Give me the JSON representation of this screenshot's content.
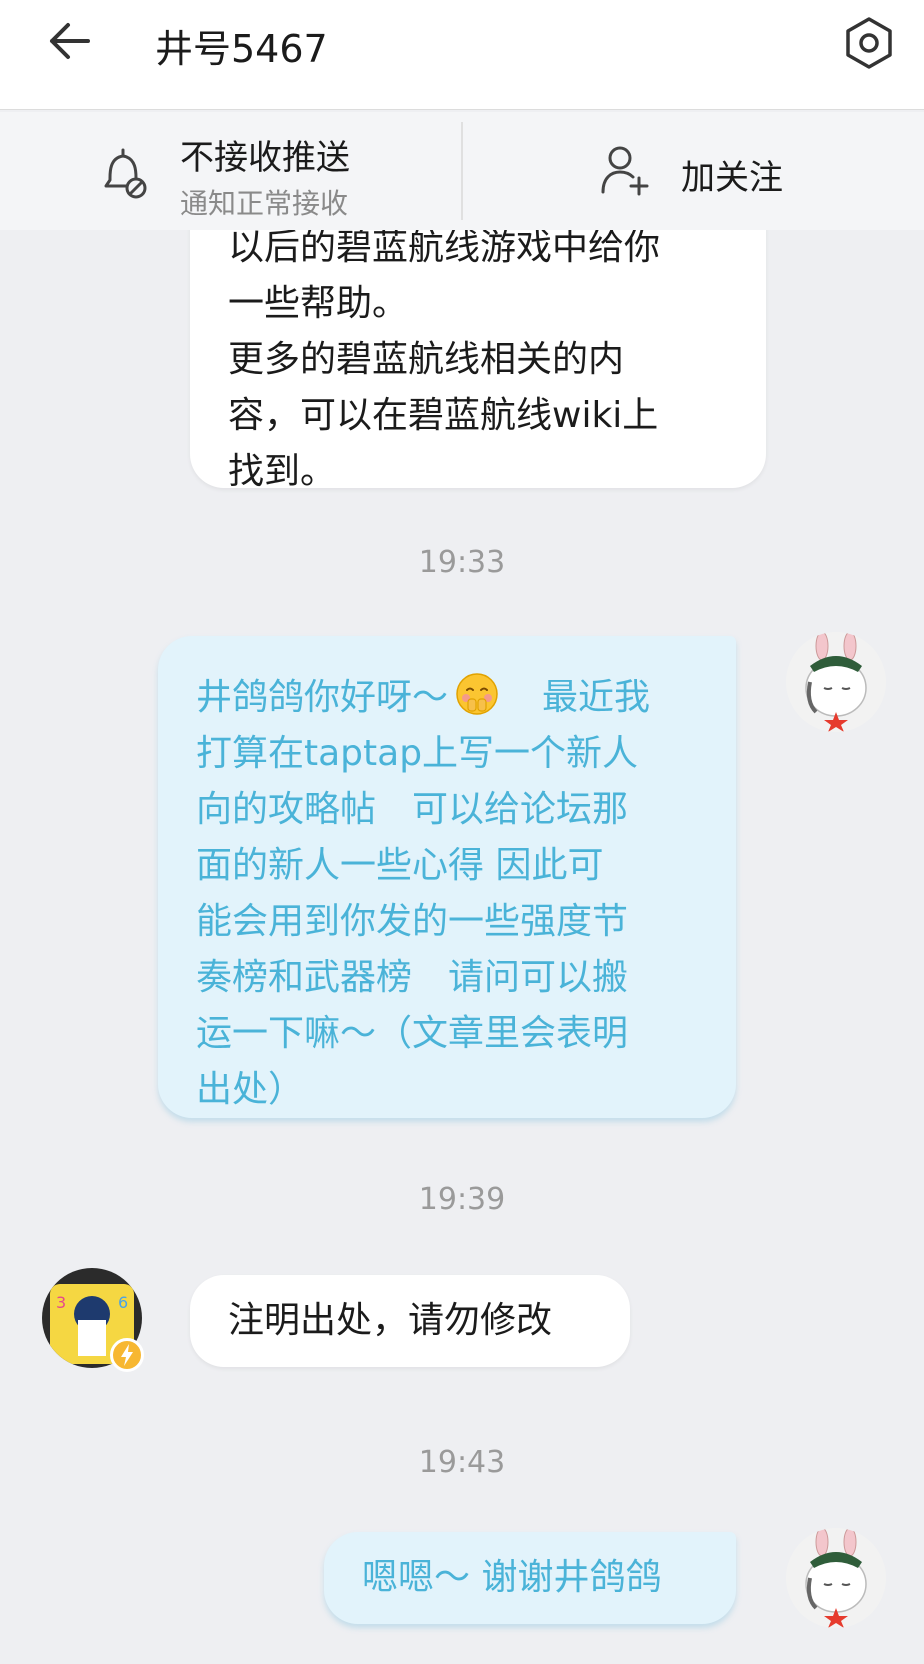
{
  "header": {
    "title": "井号5467"
  },
  "action_bar": {
    "push_title": "不接收推送",
    "push_subtitle": "通知正常接收",
    "follow_label": "加关注"
  },
  "messages": [
    {
      "side": "left",
      "lines": [
        "以后的碧蓝航线游戏中给你",
        "一些帮助。",
        "更多的碧蓝航线相关的内",
        "容，可以在碧蓝航线wiki上",
        "找到。"
      ]
    },
    {
      "side": "right",
      "lines": [
        "井鸽鸽你好呀～",
        "最近我",
        "打算在taptap上写一个新人",
        "向的攻略帖　可以给论坛那",
        "面的新人一些心得  因此可",
        "能会用到你发的一些强度节",
        "奏榜和武器榜　请问可以搬",
        "运一下嘛～（文章里会表明",
        "出处）"
      ]
    },
    {
      "side": "left",
      "text": "注明出处，请勿修改"
    },
    {
      "side": "right",
      "text": "嗯嗯～ 谢谢井鸽鸽"
    }
  ],
  "timestamps": [
    "19:33",
    "19:39",
    "19:43"
  ],
  "icons": {
    "back": "back-arrow-icon",
    "settings": "hexagon-settings-icon",
    "bell": "bell-off-icon",
    "follow": "add-user-icon",
    "emoji": "shy-face-emoji"
  },
  "colors": {
    "background": "#eeeff2",
    "sent_bubble": "#e2f3fb",
    "sent_text": "#4ab3d8",
    "received_bubble": "#ffffff",
    "timestamp": "#9a9a9a"
  }
}
